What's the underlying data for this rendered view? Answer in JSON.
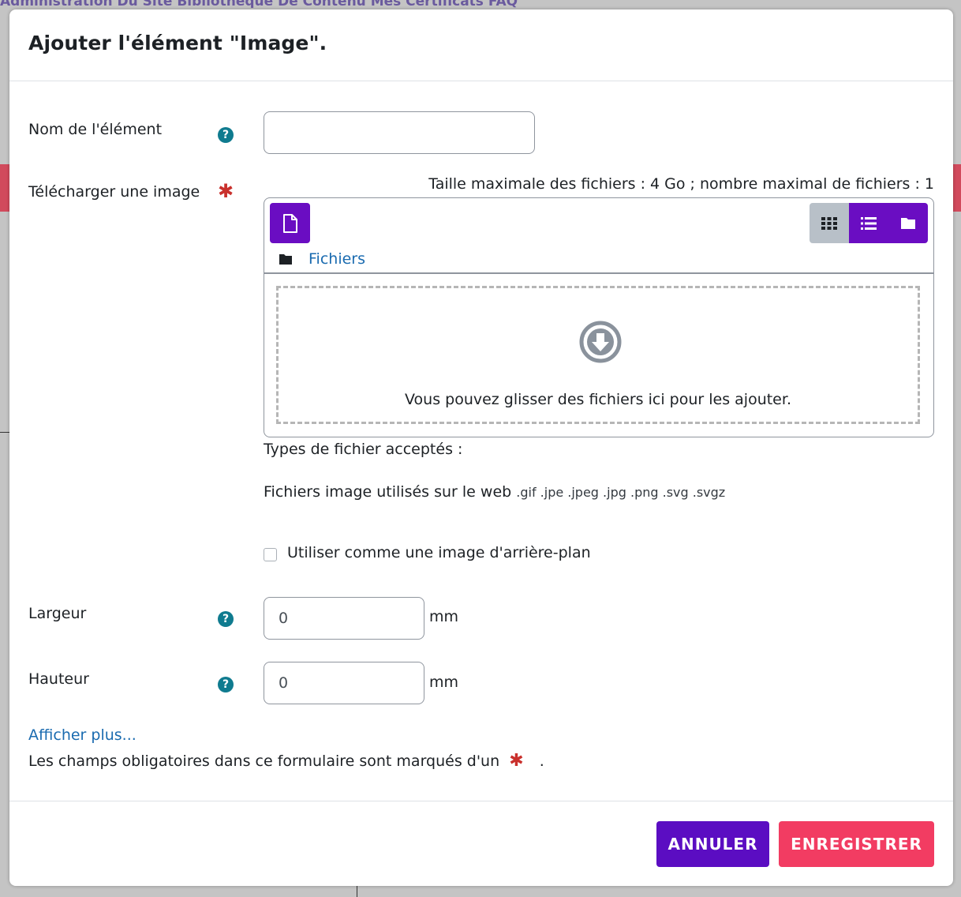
{
  "background": {
    "nav_text": "Administration Du Site   Bibliothèque De Contenu   Mes Certificats   FAQ"
  },
  "modal": {
    "title": "Ajouter l'élément \"Image\"."
  },
  "form": {
    "name_label": "Nom de l'élément",
    "name_value": "",
    "upload_label": "Télécharger une image",
    "upload_limits": "Taille maximale des fichiers : 4 Go ; nombre maximal de fichiers : 1",
    "files_path": "Fichiers",
    "drop_text": "Vous pouvez glisser des fichiers ici pour les ajouter.",
    "accepted_types_label": "Types de fichier acceptés :",
    "accepted_types_desc": "Fichiers image utilisés sur le web",
    "accepted_types_ext": ".gif .jpe .jpeg .jpg .png .svg .svgz",
    "background_checkbox_label": "Utiliser comme une image d'arrière-plan",
    "background_checkbox_checked": false,
    "width_label": "Largeur",
    "width_value": "0",
    "width_unit": "mm",
    "height_label": "Hauteur",
    "height_value": "0",
    "height_unit": "mm",
    "show_more": "Afficher plus...",
    "required_note": "Les champs obligatoires dans ce formulaire sont marqués d'un",
    "required_note_end": "."
  },
  "footer": {
    "cancel_label": "ANNULER",
    "save_label": "ENREGISTRER"
  },
  "colors": {
    "primary": "#6a0dc2",
    "save": "#f23c62",
    "help": "#0f7b8f",
    "required": "#c9302c",
    "link": "#1a6bb0"
  }
}
